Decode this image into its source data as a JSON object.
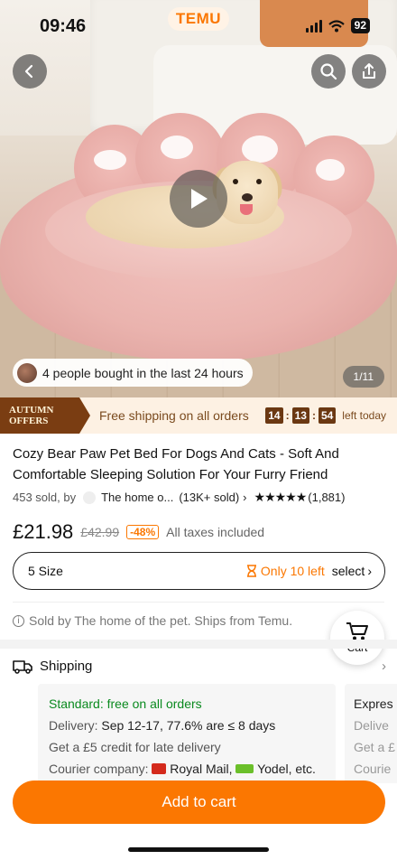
{
  "status_bar": {
    "time": "09:46",
    "app_badge": "TEMU",
    "battery": "92"
  },
  "hero": {
    "bought_text": "4 people bought in the last 24 hours",
    "image_counter": "1/11",
    "icons": {
      "back": "back-arrow-icon",
      "search": "search-icon",
      "share": "share-icon",
      "play": "play-icon"
    }
  },
  "promo": {
    "badge_line1": "AUTUMN",
    "badge_line2": "OFFERS",
    "text": "Free shipping on all orders",
    "timer": {
      "hours": "14",
      "minutes": "13",
      "seconds": "54",
      "suffix": "left today"
    }
  },
  "product": {
    "title": "Cozy Bear Paw Pet Bed For Dogs And Cats - Soft And Comfortable Sleeping Solution For Your Furry Friend",
    "sold_count": "453 sold, by",
    "store_name": "The home o...",
    "store_sold": "(13K+ sold)",
    "stars": "★★★★★",
    "rating": 4.5,
    "rating_count": "(1,881)",
    "price": "£21.98",
    "old_price": "£42.99",
    "discount": "-48%",
    "tax_note": "All taxes included"
  },
  "size_selector": {
    "size": "5 Size",
    "stock": "Only 10 left",
    "action": "select"
  },
  "sold_by": "Sold by The home of the pet. Ships from Temu.",
  "cart_button": {
    "label": "Cart"
  },
  "shipping": {
    "heading": "Shipping",
    "standard": {
      "title": "Standard: free on all orders",
      "delivery_label": "Delivery:",
      "delivery_value": "Sep 12-17, 77.6% are ≤ 8 days",
      "credit": "Get a £5 credit for late delivery",
      "courier_label": "Courier company:",
      "courier1": "Royal Mail,",
      "courier2": "Yodel,",
      "courier_more": "etc."
    },
    "express": {
      "title": "Expres",
      "line1": "Delive",
      "line2": "Get a £",
      "line3": "Courie"
    }
  },
  "add_to_cart": "Add to cart",
  "colors": {
    "accent": "#fb7701",
    "promo_brown": "#7a3d12",
    "green": "#0a8a1f"
  }
}
